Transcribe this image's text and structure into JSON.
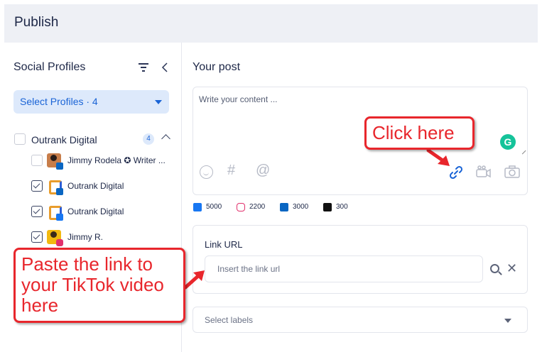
{
  "header": {
    "title": "Publish"
  },
  "sidebar": {
    "title": "Social Profiles",
    "select_profiles_label": "Select Profiles · 4",
    "group": {
      "label": "Outrank Digital",
      "count": "4"
    },
    "profiles": [
      {
        "label": "Jimmy Rodela ✪ Writer ...",
        "checked": false,
        "network": "linkedin"
      },
      {
        "label": "Outrank Digital",
        "checked": true,
        "network": "linkedin"
      },
      {
        "label": "Outrank Digital",
        "checked": true,
        "network": "facebook"
      },
      {
        "label": "Jimmy R.",
        "checked": true,
        "network": "instagram"
      }
    ]
  },
  "main": {
    "title": "Your post",
    "editor": {
      "placeholder": "Write your content ..."
    },
    "char_limits": [
      {
        "network": "facebook",
        "value": "5000"
      },
      {
        "network": "instagram",
        "value": "2200"
      },
      {
        "network": "linkedin",
        "value": "3000"
      },
      {
        "network": "tiktok",
        "value": "300"
      }
    ],
    "link": {
      "title": "Link URL",
      "placeholder": "Insert the link url"
    },
    "labels": {
      "placeholder": "Select labels"
    }
  },
  "annotations": {
    "click_here": "Click here",
    "paste_link_lines": [
      "Paste the link to",
      "your TikTok video",
      "here"
    ]
  },
  "colors": {
    "accent": "#1a64d6",
    "callout": "#e8262c",
    "header_bg": "#eef0f5",
    "grammarly": "#15c39a"
  }
}
